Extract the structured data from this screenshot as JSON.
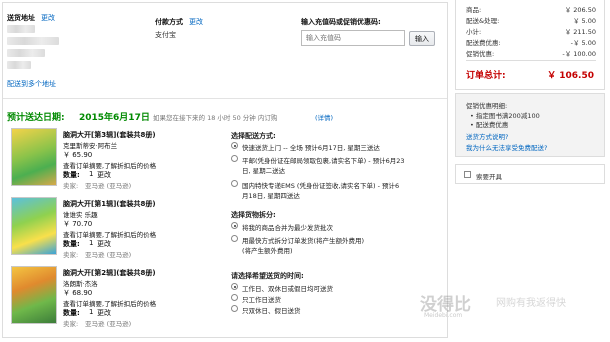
{
  "address": {
    "title": "送货地址",
    "change": "更改",
    "link": "配送到多个地址"
  },
  "payment": {
    "title": "付款方式",
    "change": "更改",
    "method": "支付宝"
  },
  "coupon": {
    "title": "输入充值码或促销优惠码:",
    "placeholder": "输入充值码",
    "button": "输入"
  },
  "delivery": {
    "label": "预计送达日期:",
    "date": "2015年6月17日",
    "note": "如果您在接下来的 18 小时 50 分钟 内订购",
    "detail": "(详情)"
  },
  "items": [
    {
      "title": "脑洞大开[第3辑](套装共8册)",
      "author": "克里斯蒂安·阿布兰",
      "price": "￥ 65.90",
      "notice": "查看订单摘要,了解折扣后的价格",
      "qty_label": "数量:",
      "qty": "1",
      "change": "更改",
      "seller_label": "卖家:",
      "seller": "亚马逊 (亚马逊)"
    },
    {
      "title": "脑洞大开[第1辑](套装共8册)",
      "author": "谁谁实 乐趣",
      "price": "￥ 70.70",
      "notice": "查看订单摘要,了解折扣后的价格",
      "qty_label": "数量:",
      "qty": "1",
      "change": "更改",
      "seller_label": "卖家:",
      "seller": "亚马逊 (亚马逊)"
    },
    {
      "title": "脑洞大开[第2辑](套装共8册)",
      "author": "洛朗斯·杰洛",
      "price": "￥ 68.90",
      "notice": "查看订单摘要,了解折扣后的价格",
      "qty_label": "数量:",
      "qty": "1",
      "change": "更改",
      "seller_label": "卖家:",
      "seller": "亚马逊 (亚马逊)"
    }
  ],
  "shipping": {
    "title": "选择配送方式:",
    "options": [
      "快速送货上门 -- 全场 预计6月17日, 星期三送达",
      "平邮(凭身份证在邮局领取包裹,请实名下单) - 预计6月23",
      "日, 星期二送达",
      "国内特快专递EMS (凭身份证签收,请实名下单) - 预计6",
      "月18日, 星期四送达"
    ]
  },
  "packaging": {
    "title": "选择货物拆分:",
    "options": [
      "将我的商品合并为最少发货批次",
      "用最快方式拆分订单发货(将产生额外费用)"
    ],
    "link": "(将产生额外费用)"
  },
  "time": {
    "title": "请选择希望送货的时间:",
    "options": [
      "工作日、双休日或假日均可送货",
      "只工作日送货",
      "只双休日、假日送货"
    ]
  },
  "summary": {
    "rows": [
      {
        "label": "商品:",
        "value": "￥ 206.50"
      },
      {
        "label": "配送&处理:",
        "value": "￥ 5.00"
      },
      {
        "label": "小计:",
        "value": "￥ 211.50"
      },
      {
        "label": "配送费优惠:",
        "value": "-￥ 5.00"
      },
      {
        "label": "促销优惠:",
        "value": "-￥ 100.00"
      }
    ],
    "total_label": "订单总计:",
    "total_value": "￥ 106.50"
  },
  "promo": {
    "title": "促销优惠明细:",
    "lines": [
      "指定图书满200减100",
      "配送费优惠"
    ],
    "link1": "送货方式说明?",
    "link2": "我为什么无法享受免费配送?"
  },
  "gift": {
    "label": "索要开具"
  },
  "watermark": {
    "text": "没得比",
    "sub": "Meidebi.com",
    "slogan": "网购有我返得快"
  }
}
